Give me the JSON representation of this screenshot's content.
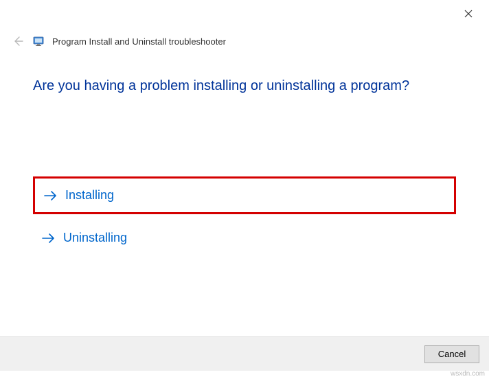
{
  "window": {
    "title": "Program Install and Uninstall troubleshooter"
  },
  "question": "Are you having a problem installing or uninstalling a program?",
  "options": {
    "installing": "Installing",
    "uninstalling": "Uninstalling"
  },
  "footer": {
    "cancel": "Cancel"
  },
  "watermark": "wsxdn.com"
}
